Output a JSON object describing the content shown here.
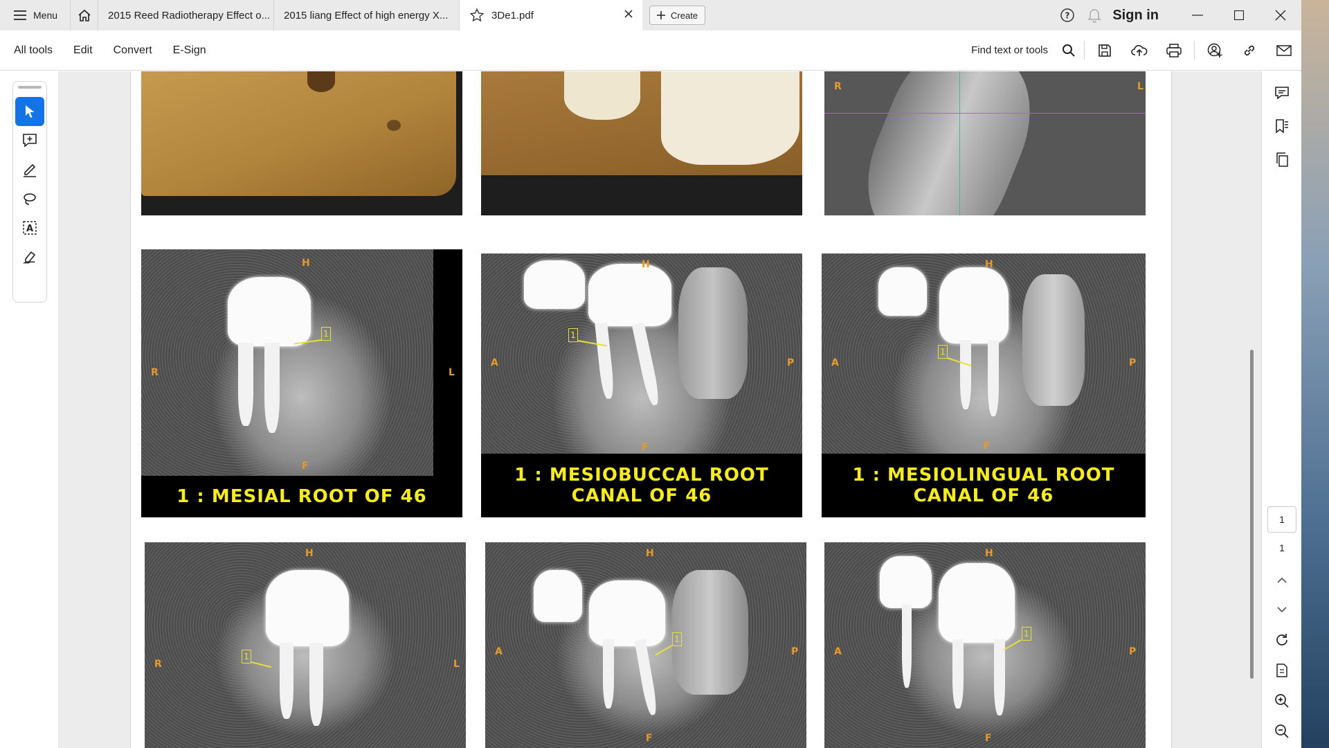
{
  "tabbar": {
    "menu_label": "Menu",
    "tabs": [
      {
        "label": "2015 Reed Radiotherapy Effect o..."
      },
      {
        "label": "2015 liang Effect of high energy X..."
      },
      {
        "label": "3De1.pdf"
      }
    ],
    "create_label": "Create",
    "signin_label": "Sign in"
  },
  "toolbar": {
    "items": [
      "All tools",
      "Edit",
      "Convert",
      "E-Sign"
    ],
    "find_label": "Find text or tools"
  },
  "figures": {
    "row1": {
      "image3_left": "R",
      "image3_right": "L"
    },
    "row2": [
      {
        "caption": "1 :  MESIAL ROOT OF 46",
        "top": "H",
        "left": "R",
        "right": "L",
        "bottom": "F",
        "marker": "1"
      },
      {
        "caption": "1 :  MESIOBUCCAL ROOT CANAL OF 46",
        "top": "H",
        "left": "A",
        "right": "P",
        "bottom": "F",
        "marker": "1"
      },
      {
        "caption": "1 :  MESIOLINGUAL ROOT CANAL OF 46",
        "top": "H",
        "left": "A",
        "right": "P",
        "bottom": "F",
        "marker": "1"
      }
    ],
    "row3": [
      {
        "top": "H",
        "left": "R",
        "right": "L",
        "marker": "1"
      },
      {
        "top": "H",
        "left": "A",
        "right": "P",
        "bottom": "F",
        "marker": "1"
      },
      {
        "top": "H",
        "left": "A",
        "right": "P",
        "bottom": "F",
        "marker": "1"
      }
    ]
  },
  "pagination": {
    "current": "1",
    "total": "1"
  },
  "colors": {
    "accent": "#1473e6",
    "caption_text": "#f6ec1c",
    "orientation_label": "#e79a2c"
  }
}
